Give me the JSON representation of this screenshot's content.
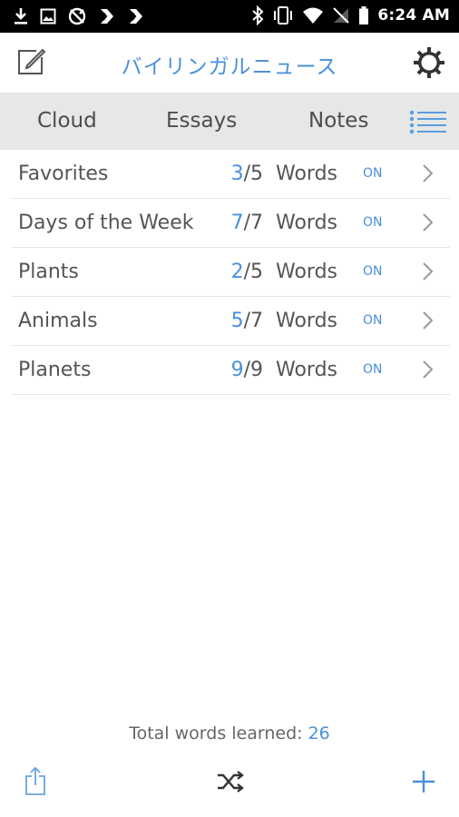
{
  "status_bar": {
    "time": "6:24 AM",
    "left_icons": [
      "download-icon",
      "image-icon",
      "sync-app-icon",
      "app-icon",
      "app-icon"
    ],
    "right_icons": [
      "bluetooth-icon",
      "vibrate-icon",
      "wifi-icon",
      "no-signal-icon",
      "battery-icon"
    ]
  },
  "header": {
    "title": "バイリンガルニュース",
    "left_icon": "edit-icon",
    "right_icon": "gear-icon"
  },
  "tabs": [
    {
      "label": "Cloud"
    },
    {
      "label": "Essays"
    },
    {
      "label": "Notes"
    }
  ],
  "tab_icon": "list-view-icon",
  "lists": [
    {
      "name": "Favorites",
      "learned": "3",
      "total": "/5",
      "words": "Words",
      "toggle": "ON"
    },
    {
      "name": "Days of the Week",
      "learned": "7",
      "total": "/7",
      "words": "Words",
      "toggle": "ON"
    },
    {
      "name": "Plants",
      "learned": "2",
      "total": "/5",
      "words": "Words",
      "toggle": "ON"
    },
    {
      "name": "Animals",
      "learned": "5",
      "total": "/7",
      "words": "Words",
      "toggle": "ON"
    },
    {
      "name": "Planets",
      "learned": "9",
      "total": "/9",
      "words": "Words",
      "toggle": "ON"
    }
  ],
  "footer": {
    "total_label": "Total words learned: ",
    "total_value": "26",
    "icons": [
      "share-icon",
      "shuffle-icon",
      "plus-icon"
    ]
  },
  "colors": {
    "accent": "#4a90d9",
    "tab_bar_bg": "#e7e7e7",
    "text": "#555555"
  }
}
